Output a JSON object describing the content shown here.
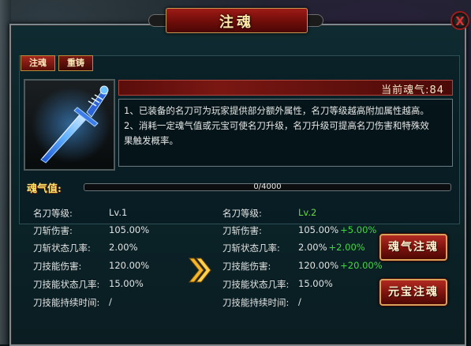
{
  "window": {
    "title": "注魂",
    "close_label": "X"
  },
  "tabs": [
    {
      "label": "注魂",
      "active": true
    },
    {
      "label": "重铸",
      "active": false
    }
  ],
  "soul_header": {
    "label": "当前魂气:84"
  },
  "description": {
    "line1": "1、已装备的名刀可为玩家提供部分额外属性，名刀等级越高附加属性越高。",
    "line2": "2、消耗一定魂气值或元宝可使名刀升级，名刀升级可提高名刀伤害和特殊效",
    "line3": "果触发概率。"
  },
  "soul_value": {
    "label": "魂气值:",
    "text": "0/4000",
    "fraction": 0
  },
  "current_stats": {
    "level_name": "名刀等级:",
    "level_value": "Lv.1",
    "rows": [
      {
        "name": "刀斩伤害:",
        "value": "105.00%"
      },
      {
        "name": "刀斩状态几率:",
        "value": "2.00%"
      },
      {
        "name": "刀技能伤害:",
        "value": "120.00%"
      },
      {
        "name": "刀技能状态几率:",
        "value": "15.00%"
      },
      {
        "name": "刀技能持续时间:",
        "value": "/"
      }
    ]
  },
  "next_stats": {
    "level_name": "名刀等级:",
    "level_value": "Lv.2",
    "rows": [
      {
        "name": "刀斩伤害:",
        "value": "105.00%",
        "inc": "+5.00%"
      },
      {
        "name": "刀斩状态几率:",
        "value": "2.00%",
        "inc": "+2.00%"
      },
      {
        "name": "刀技能伤害:",
        "value": "120.00%",
        "inc": "+20.00%"
      },
      {
        "name": "刀技能状态几率:",
        "value": "15.00%",
        "inc": ""
      },
      {
        "name": "刀技能持续时间:",
        "value": "/",
        "inc": ""
      }
    ]
  },
  "buttons": {
    "soul_inject": "魂气注魂",
    "gold_inject": "元宝注魂"
  },
  "icons": {
    "close": "close-icon",
    "sword": "sword-icon",
    "arrow": "double-chevron-right-icon"
  },
  "colors": {
    "accent_red": "#9e1b16",
    "gold": "#ffe36a",
    "increase_green": "#3edb3e"
  }
}
